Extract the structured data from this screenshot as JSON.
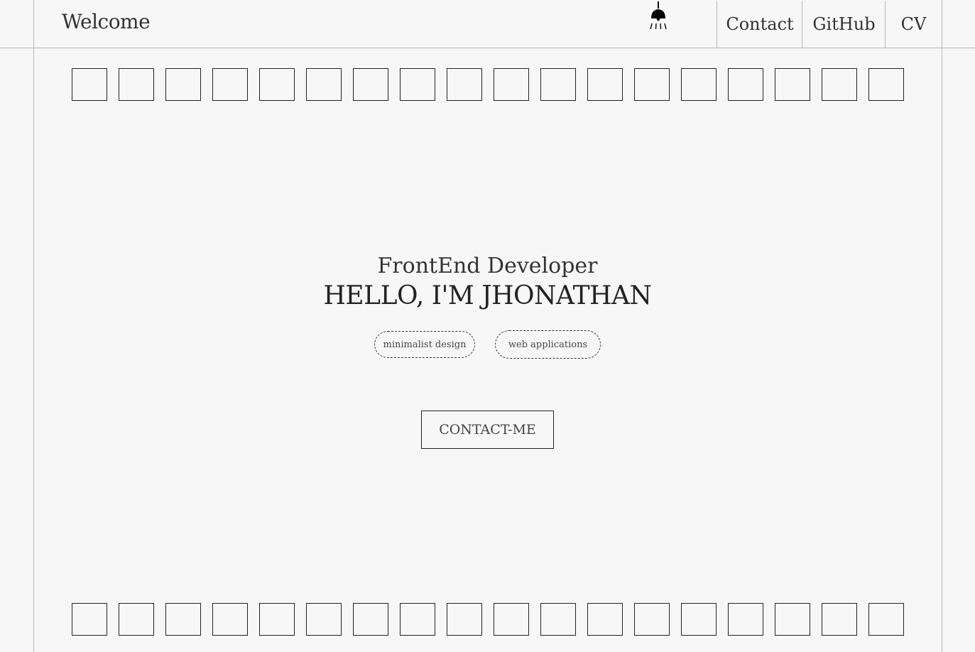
{
  "header": {
    "brand": "Welcome",
    "lamp_icon": "lamp-icon",
    "nav": [
      {
        "label": "Contact"
      },
      {
        "label": "GitHub"
      },
      {
        "label": "CV"
      }
    ]
  },
  "decor": {
    "top_squares_count": 18,
    "bottom_squares_count": 18
  },
  "hero": {
    "role": "FrontEnd Developer",
    "greeting": "HELLO, I'M JHONATHAN",
    "tags": [
      "minimalist design",
      "web applications"
    ],
    "cta": "CONTACT-ME"
  },
  "colors": {
    "background": "#f7f7f7",
    "line": "#b7b7b7",
    "ink": "#222222"
  }
}
